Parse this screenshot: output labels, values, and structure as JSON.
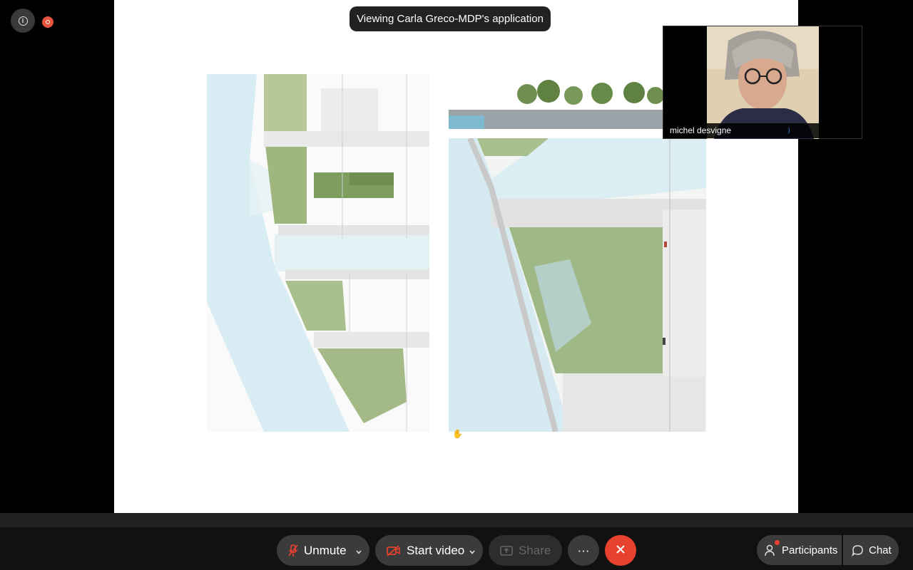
{
  "meeting": {
    "viewing_label": "Viewing Carla Greco-MDP's application"
  },
  "participant_video": {
    "name": "michel desvigne"
  },
  "toolbar": {
    "unmute_label": "Unmute",
    "start_video_label": "Start video",
    "share_label": "Share",
    "more_label": "···",
    "participants_label": "Participants",
    "chat_label": "Chat"
  },
  "colors": {
    "end_button": "#e8412f",
    "recording": "#e5533d",
    "video_off_icon": "#e8412f",
    "mic_off_icon": "#e8412f"
  },
  "icons": {
    "info": "info-icon",
    "recording": "recording-icon",
    "microphone_off": "microphone-off-icon",
    "video_off": "video-off-icon",
    "share": "share-screen-icon",
    "more": "more-options-icon",
    "end": "close-icon",
    "participants": "participants-icon",
    "chat": "chat-icon"
  }
}
